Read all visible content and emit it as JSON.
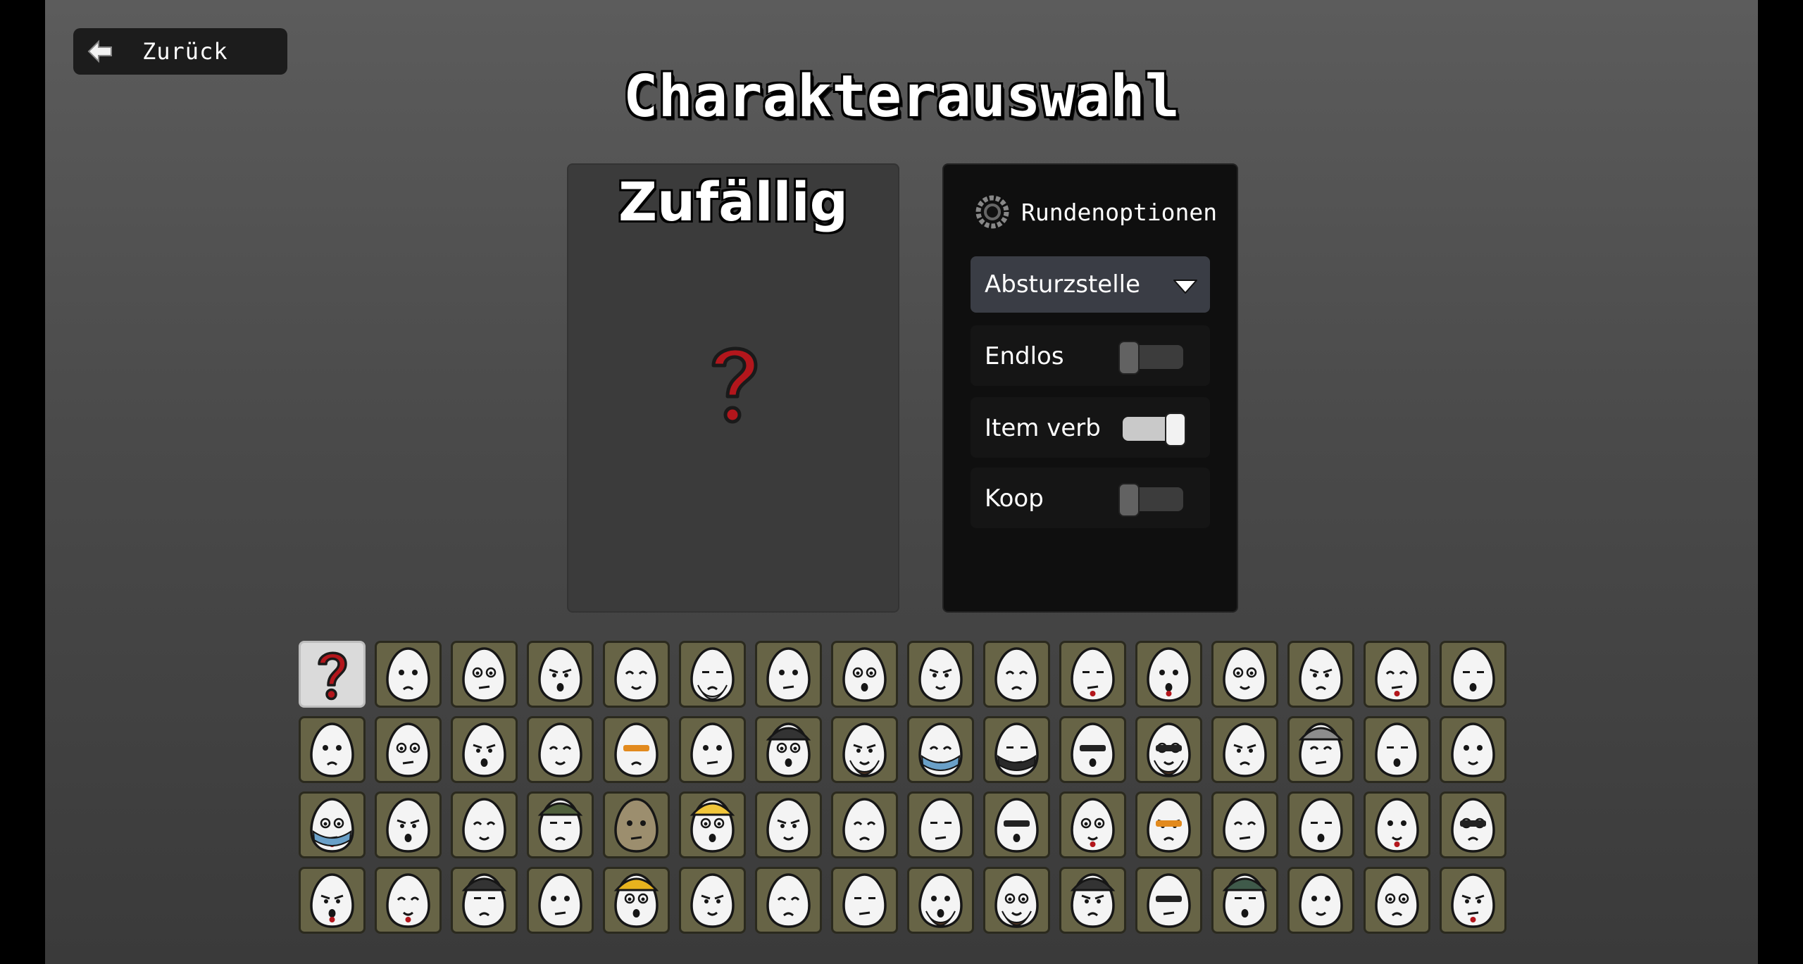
{
  "header": {
    "back_label": "Zurück",
    "title": "Charakterauswahl"
  },
  "preview": {
    "name": "Zufällig"
  },
  "options": {
    "heading": "Rundenoptionen",
    "mode_selected": "Absturzstelle",
    "toggles": [
      {
        "label": "Endlos",
        "on": false
      },
      {
        "label": "Item verb",
        "on": true
      },
      {
        "label": "Koop",
        "on": false
      }
    ]
  },
  "colors": {
    "cell_bg": "#676446",
    "selected_bg": "#dadada",
    "accent_red": "#b3161c"
  },
  "characters": {
    "rows": [
      [
        "random",
        "frown",
        "blackeye",
        "sleepy",
        "monocle",
        "beard-grey",
        "pout",
        "mustache-big",
        "eyes-dot",
        "many-eyes",
        "brows-red",
        "shout-red",
        "blush",
        "sad",
        "heart-eyes",
        "bug-eyes"
      ],
      [
        "plain",
        "sweat",
        "goatee",
        "surprised",
        "orange-glasses",
        "suit",
        "helmet",
        "wild-beard",
        "bandana-mask",
        "ninja",
        "glasses-grin",
        "sunglasses-beard",
        "green-mouth",
        "viking",
        "drool",
        "faint"
      ],
      [
        "red-mask",
        "crying",
        "beak",
        "bucket-hat",
        "potato",
        "crown",
        "mohawk",
        "calm",
        "spike-collar",
        "visor",
        "red-eye",
        "orange-mustache",
        "yellow-eyes",
        "pacifier",
        "scarf",
        "cyber-eyes"
      ],
      [
        "vampire",
        "red-fox",
        "fedora-suit",
        "open-mouth",
        "hardhat",
        "goatee-dark",
        "gold-teeth",
        "smirk",
        "spiky-beard",
        "long-beard",
        "top-hat",
        "goggles",
        "beanie",
        "pirate",
        "neutral",
        "cigar"
      ]
    ]
  }
}
